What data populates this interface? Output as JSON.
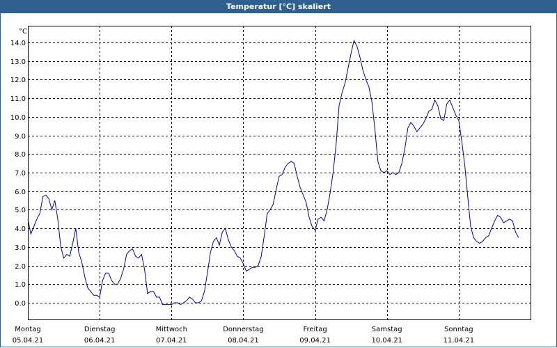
{
  "window": {
    "title": "Temperatur [°C] skaliert"
  },
  "chart_data": {
    "type": "line",
    "title": "Temperatur [°C] skaliert",
    "ylabel": "°C",
    "xlabel": "",
    "ylim": [
      -0.9,
      14.9
    ],
    "yticks": [
      0.0,
      1.0,
      2.0,
      3.0,
      4.0,
      5.0,
      6.0,
      7.0,
      8.0,
      9.0,
      10.0,
      11.0,
      12.0,
      13.0,
      14.0
    ],
    "ytick_labels": [
      "0.0",
      "1.0",
      "2.0",
      "3.0",
      "4.0",
      "5.0",
      "6.0",
      "7.0",
      "8.0",
      "9.0",
      "10.0",
      "11.0",
      "12.0",
      "13.0",
      "14.0"
    ],
    "xlim": [
      "05.04.21 00:00",
      "12.04.21 00:00"
    ],
    "grid": true,
    "line_color": "#0000a0",
    "x_days": [
      {
        "weekday": "Montag",
        "date": "05.04.21"
      },
      {
        "weekday": "Dienstag",
        "date": "06.04.21"
      },
      {
        "weekday": "Mittwoch",
        "date": "07.04.21"
      },
      {
        "weekday": "Donnerstag",
        "date": "08.04.21"
      },
      {
        "weekday": "Freitag",
        "date": "09.04.21"
      },
      {
        "weekday": "Samstag",
        "date": "10.04.21"
      },
      {
        "weekday": "Sonntag",
        "date": "11.04.21"
      }
    ],
    "series": [
      {
        "values": [
          [
            "05.04.21 00:00",
            4.5
          ],
          [
            "05.04.21 01:00",
            3.7
          ],
          [
            "05.04.21 02:00",
            4.1
          ],
          [
            "05.04.21 03:00",
            4.5
          ],
          [
            "05.04.21 04:00",
            4.8
          ],
          [
            "05.04.21 05:00",
            5.7
          ],
          [
            "05.04.21 06:00",
            5.8
          ],
          [
            "05.04.21 07:00",
            5.6
          ],
          [
            "05.04.21 08:00",
            5.0
          ],
          [
            "05.04.21 09:00",
            5.5
          ],
          [
            "05.04.21 10:00",
            4.5
          ],
          [
            "05.04.21 11:00",
            3.0
          ],
          [
            "05.04.21 12:00",
            2.4
          ],
          [
            "05.04.21 13:00",
            2.6
          ],
          [
            "05.04.21 14:00",
            2.5
          ],
          [
            "05.04.21 15:00",
            3.2
          ],
          [
            "05.04.21 16:00",
            4.0
          ],
          [
            "05.04.21 17:00",
            2.7
          ],
          [
            "05.04.21 18:00",
            2.2
          ],
          [
            "05.04.21 19:00",
            1.4
          ],
          [
            "05.04.21 20:00",
            0.8
          ],
          [
            "05.04.21 21:00",
            0.6
          ],
          [
            "05.04.21 22:00",
            0.4
          ],
          [
            "05.04.21 23:00",
            0.4
          ],
          [
            "06.04.21 00:00",
            0.3
          ],
          [
            "06.04.21 01:00",
            1.2
          ],
          [
            "06.04.21 02:00",
            1.6
          ],
          [
            "06.04.21 03:00",
            1.6
          ],
          [
            "06.04.21 04:00",
            1.2
          ],
          [
            "06.04.21 05:00",
            1.0
          ],
          [
            "06.04.21 06:00",
            1.0
          ],
          [
            "06.04.21 07:00",
            1.3
          ],
          [
            "06.04.21 08:00",
            1.8
          ],
          [
            "06.04.21 09:00",
            2.6
          ],
          [
            "06.04.21 10:00",
            2.8
          ],
          [
            "06.04.21 11:00",
            2.9
          ],
          [
            "06.04.21 12:00",
            2.5
          ],
          [
            "06.04.21 13:00",
            2.4
          ],
          [
            "06.04.21 14:00",
            2.6
          ],
          [
            "06.04.21 15:00",
            1.8
          ],
          [
            "06.04.21 16:00",
            0.5
          ],
          [
            "06.04.21 17:00",
            0.6
          ],
          [
            "06.04.21 18:00",
            0.6
          ],
          [
            "06.04.21 19:00",
            0.3
          ],
          [
            "06.04.21 20:00",
            0.3
          ],
          [
            "06.04.21 21:00",
            -0.1
          ],
          [
            "06.04.21 22:00",
            -0.1
          ],
          [
            "06.04.21 23:00",
            -0.1
          ],
          [
            "07.04.21 00:00",
            -0.1
          ],
          [
            "07.04.21 01:00",
            0.0
          ],
          [
            "07.04.21 02:00",
            0.0
          ],
          [
            "07.04.21 03:00",
            -0.1
          ],
          [
            "07.04.21 04:00",
            0.0
          ],
          [
            "07.04.21 05:00",
            0.1
          ],
          [
            "07.04.21 06:00",
            0.3
          ],
          [
            "07.04.21 07:00",
            0.2
          ],
          [
            "07.04.21 08:00",
            0.0
          ],
          [
            "07.04.21 09:00",
            0.0
          ],
          [
            "07.04.21 10:00",
            0.1
          ],
          [
            "07.04.21 11:00",
            0.6
          ],
          [
            "07.04.21 12:00",
            1.6
          ],
          [
            "07.04.21 13:00",
            2.7
          ],
          [
            "07.04.21 14:00",
            3.3
          ],
          [
            "07.04.21 15:00",
            3.5
          ],
          [
            "07.04.21 16:00",
            3.1
          ],
          [
            "07.04.21 17:00",
            3.8
          ],
          [
            "07.04.21 18:00",
            4.0
          ],
          [
            "07.04.21 19:00",
            3.4
          ],
          [
            "07.04.21 20:00",
            3.0
          ],
          [
            "07.04.21 21:00",
            2.8
          ],
          [
            "07.04.21 22:00",
            2.5
          ],
          [
            "07.04.21 23:00",
            2.4
          ],
          [
            "08.04.21 00:00",
            2.1
          ],
          [
            "08.04.21 01:00",
            1.7
          ],
          [
            "08.04.21 02:00",
            1.8
          ],
          [
            "08.04.21 03:00",
            1.9
          ],
          [
            "08.04.21 04:00",
            1.9
          ],
          [
            "08.04.21 05:00",
            2.0
          ],
          [
            "08.04.21 06:00",
            2.5
          ],
          [
            "08.04.21 07:00",
            3.6
          ],
          [
            "08.04.21 08:00",
            4.8
          ],
          [
            "08.04.21 09:00",
            5.0
          ],
          [
            "08.04.21 10:00",
            5.3
          ],
          [
            "08.04.21 11:00",
            6.1
          ],
          [
            "08.04.21 12:00",
            6.8
          ],
          [
            "08.04.21 13:00",
            6.9
          ],
          [
            "08.04.21 14:00",
            7.3
          ],
          [
            "08.04.21 15:00",
            7.5
          ],
          [
            "08.04.21 16:00",
            7.6
          ],
          [
            "08.04.21 17:00",
            7.5
          ],
          [
            "08.04.21 18:00",
            6.8
          ],
          [
            "08.04.21 19:00",
            6.2
          ],
          [
            "08.04.21 20:00",
            5.8
          ],
          [
            "08.04.21 21:00",
            5.4
          ],
          [
            "08.04.21 22:00",
            4.6
          ],
          [
            "08.04.21 23:00",
            4.1
          ],
          [
            "09.04.21 00:00",
            3.9
          ],
          [
            "09.04.21 01:00",
            4.5
          ],
          [
            "09.04.21 02:00",
            4.6
          ],
          [
            "09.04.21 03:00",
            4.4
          ],
          [
            "09.04.21 04:00",
            5.0
          ],
          [
            "09.04.21 05:00",
            5.9
          ],
          [
            "09.04.21 06:00",
            7.0
          ],
          [
            "09.04.21 07:00",
            8.5
          ],
          [
            "09.04.21 08:00",
            10.6
          ],
          [
            "09.04.21 09:00",
            11.3
          ],
          [
            "09.04.21 10:00",
            11.8
          ],
          [
            "09.04.21 11:00",
            12.6
          ],
          [
            "09.04.21 12:00",
            13.4
          ],
          [
            "09.04.21 13:00",
            14.1
          ],
          [
            "09.04.21 14:00",
            13.8
          ],
          [
            "09.04.21 15:00",
            13.2
          ],
          [
            "09.04.21 16:00",
            12.5
          ],
          [
            "09.04.21 17:00",
            12.0
          ],
          [
            "09.04.21 18:00",
            11.6
          ],
          [
            "09.04.21 19:00",
            10.8
          ],
          [
            "09.04.21 20:00",
            9.3
          ],
          [
            "09.04.21 21:00",
            7.6
          ],
          [
            "09.04.21 22:00",
            7.1
          ],
          [
            "09.04.21 23:00",
            7.0
          ],
          [
            "10.04.21 00:00",
            7.1
          ],
          [
            "10.04.21 01:00",
            6.9
          ],
          [
            "10.04.21 02:00",
            7.0
          ],
          [
            "10.04.21 03:00",
            6.9
          ],
          [
            "10.04.21 04:00",
            7.0
          ],
          [
            "10.04.21 05:00",
            7.5
          ],
          [
            "10.04.21 06:00",
            8.3
          ],
          [
            "10.04.21 07:00",
            9.4
          ],
          [
            "10.04.21 08:00",
            9.7
          ],
          [
            "10.04.21 09:00",
            9.5
          ],
          [
            "10.04.21 10:00",
            9.2
          ],
          [
            "10.04.21 11:00",
            9.4
          ],
          [
            "10.04.21 12:00",
            9.6
          ],
          [
            "10.04.21 13:00",
            9.9
          ],
          [
            "10.04.21 14:00",
            10.3
          ],
          [
            "10.04.21 15:00",
            10.4
          ],
          [
            "10.04.21 16:00",
            10.9
          ],
          [
            "10.04.21 17:00",
            10.6
          ],
          [
            "10.04.21 18:00",
            9.9
          ],
          [
            "10.04.21 19:00",
            9.8
          ],
          [
            "10.04.21 20:00",
            10.7
          ],
          [
            "10.04.21 21:00",
            10.9
          ],
          [
            "10.04.21 22:00",
            10.5
          ],
          [
            "10.04.21 23:00",
            10.1
          ],
          [
            "11.04.21 00:00",
            9.8
          ],
          [
            "11.04.21 01:00",
            8.7
          ],
          [
            "11.04.21 02:00",
            7.4
          ],
          [
            "11.04.21 03:00",
            5.7
          ],
          [
            "11.04.21 04:00",
            4.1
          ],
          [
            "11.04.21 05:00",
            3.5
          ],
          [
            "11.04.21 06:00",
            3.3
          ],
          [
            "11.04.21 07:00",
            3.2
          ],
          [
            "11.04.21 08:00",
            3.3
          ],
          [
            "11.04.21 09:00",
            3.5
          ],
          [
            "11.04.21 10:00",
            3.6
          ],
          [
            "11.04.21 11:00",
            4.0
          ],
          [
            "11.04.21 12:00",
            4.4
          ],
          [
            "11.04.21 13:00",
            4.7
          ],
          [
            "11.04.21 14:00",
            4.6
          ],
          [
            "11.04.21 15:00",
            4.3
          ],
          [
            "11.04.21 16:00",
            4.4
          ],
          [
            "11.04.21 17:00",
            4.5
          ],
          [
            "11.04.21 18:00",
            4.4
          ],
          [
            "11.04.21 19:00",
            3.8
          ],
          [
            "11.04.21 20:00",
            3.5
          ]
        ]
      }
    ]
  }
}
